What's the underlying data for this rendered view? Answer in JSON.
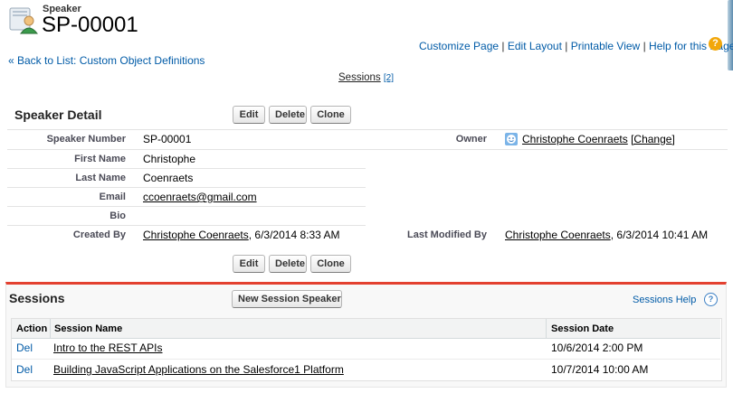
{
  "header": {
    "object_type": "Speaker",
    "record_name": "SP-00001",
    "links": [
      "Customize Page",
      "Edit Layout",
      "Printable View",
      "Help for this Page"
    ],
    "back_link": "« Back to List: Custom Object Definitions",
    "related_list_link": "Sessions",
    "related_list_count": "[2]"
  },
  "detail": {
    "title": "Speaker Detail",
    "buttons": [
      "Edit",
      "Delete",
      "Clone"
    ],
    "fields": {
      "speaker_number": {
        "label": "Speaker Number",
        "value": "SP-00001"
      },
      "owner": {
        "label": "Owner",
        "value": "Christophe Coenraets",
        "action": "[Change]"
      },
      "first_name": {
        "label": "First Name",
        "value": "Christophe"
      },
      "last_name": {
        "label": "Last Name",
        "value": "Coenraets"
      },
      "email": {
        "label": "Email",
        "value": "ccoenraets@gmail.com"
      },
      "bio": {
        "label": "Bio",
        "value": ""
      },
      "created_by": {
        "label": "Created By",
        "user": "Christophe Coenraets",
        "date": ", 6/3/2014 8:33 AM"
      },
      "last_modified_by": {
        "label": "Last Modified By",
        "user": "Christophe Coenraets",
        "date": ", 6/3/2014 10:41 AM"
      }
    }
  },
  "sessions": {
    "title": "Sessions",
    "new_button": "New Session Speaker",
    "help": "Sessions Help",
    "columns": [
      "Action",
      "Session Name",
      "Session Date"
    ],
    "rows": [
      {
        "action": "Del",
        "name": "Intro to the REST APIs",
        "date": "10/6/2014 2:00 PM"
      },
      {
        "action": "Del",
        "name": "Building JavaScript Applications on the Salesforce1 Platform",
        "date": "10/7/2014 10:00 AM"
      }
    ]
  },
  "colors": {
    "link": "#015ba7",
    "accent_bar": "#e3402f",
    "help_icon": "#f2a70a"
  }
}
